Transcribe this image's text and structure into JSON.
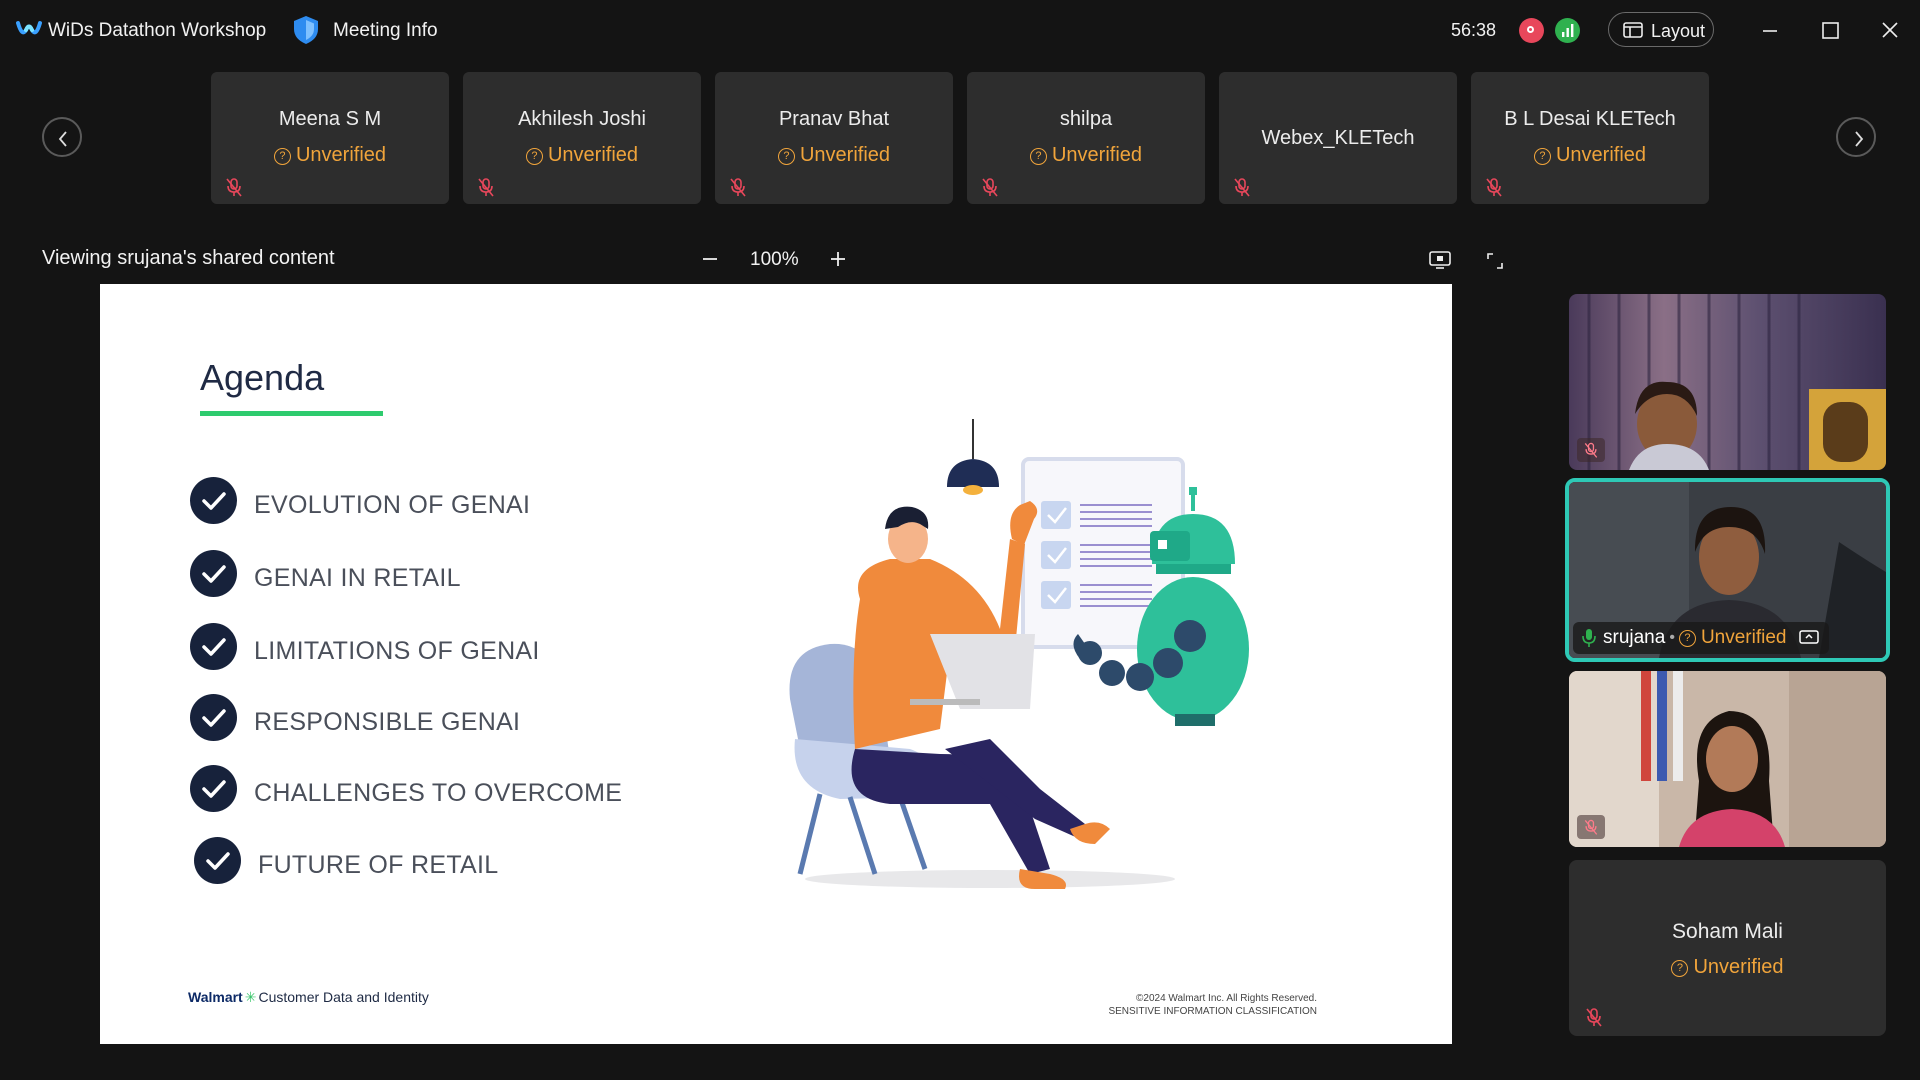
{
  "app": {
    "title": "WiDs Datathon Workshop",
    "meeting_info_label": "Meeting Info",
    "timer": "56:38",
    "layout_label": "Layout"
  },
  "participants": [
    {
      "name": "Meena S M",
      "status": "Unverified",
      "muted": true
    },
    {
      "name": "Akhilesh Joshi",
      "status": "Unverified",
      "muted": true
    },
    {
      "name": "Pranav Bhat",
      "status": "Unverified",
      "muted": true
    },
    {
      "name": "shilpa",
      "status": "Unverified",
      "muted": true
    },
    {
      "name": "Webex_KLETech",
      "status": "",
      "muted": true
    },
    {
      "name": "B L Desai KLETech",
      "status": "Unverified",
      "muted": true
    }
  ],
  "share_bar": {
    "viewing_text": "Viewing srujana's shared content",
    "zoom": "100%"
  },
  "slide": {
    "title": "Agenda",
    "items": [
      "EVOLUTION OF GENAI",
      "GENAI IN RETAIL",
      "LIMITATIONS OF GENAI",
      "RESPONSIBLE GENAI",
      "CHALLENGES TO OVERCOME",
      "FUTURE OF RETAIL"
    ],
    "footer_brand": "Walmart",
    "footer_sub": "Customer Data and Identity",
    "copyright_line1": "©2024 Walmart Inc. All Rights Reserved.",
    "copyright_line2": "SENSITIVE INFORMATION CLASSIFICATION"
  },
  "videos": {
    "active_speaker": {
      "name": "srujana",
      "status": "Unverified"
    },
    "soham": {
      "name": "Soham Mali",
      "status": "Unverified"
    }
  },
  "colors": {
    "accent_teal": "#2ec9b6",
    "unverified_orange": "#f0a43b",
    "recording_red": "#e8475b",
    "network_green": "#2fb14f"
  }
}
